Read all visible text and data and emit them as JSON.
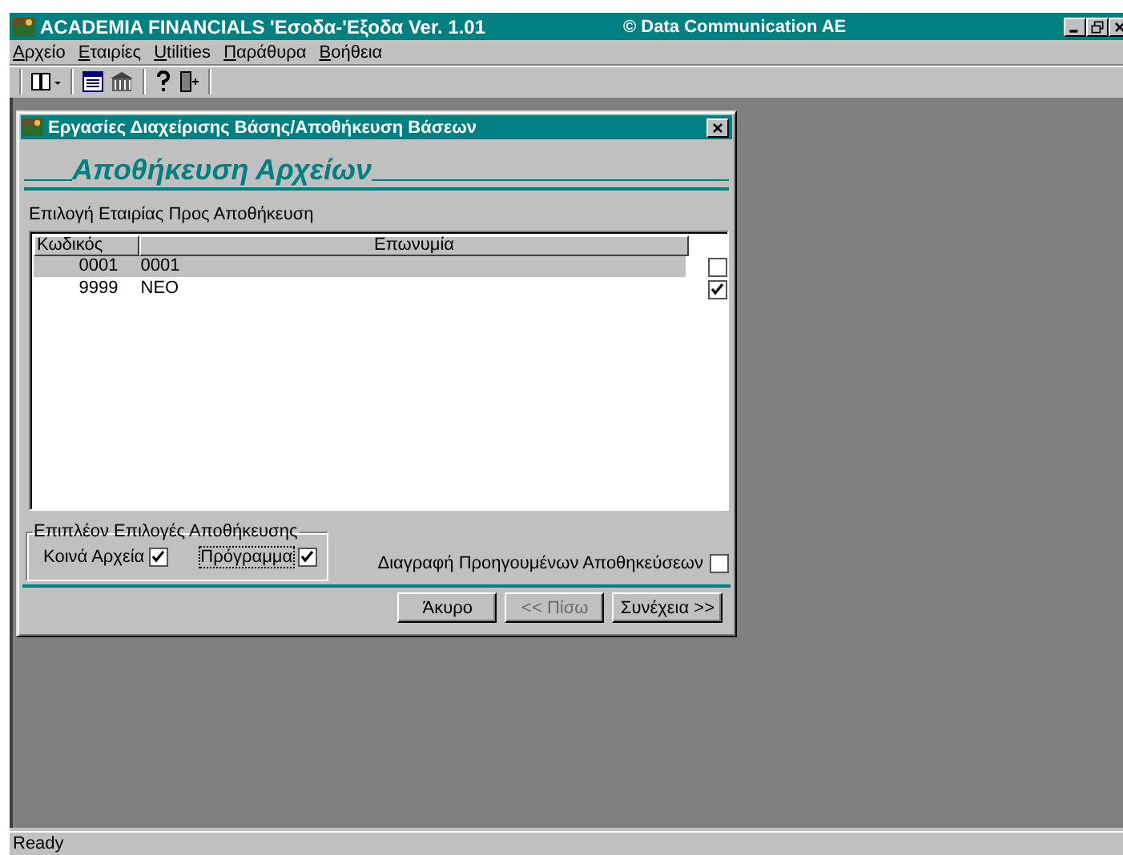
{
  "window": {
    "title": "ACADEMIA FINANCIALS 'Εσοδα-'Εξοδα Ver. 1.01",
    "company": "© Data Communication AE"
  },
  "menu": [
    "Αρχείο",
    "Εταιρίες",
    "Utilities",
    "Παράθυρα",
    "Βοήθεια"
  ],
  "dialog": {
    "title": "Εργασίες Διαχείρισης Βάσης/Αποθήκευση Βάσεων",
    "heading": "Αποθήκευση Αρχείων",
    "list_label": "Επιλογή Εταιρίας Προς Αποθήκευση",
    "table": {
      "columns": [
        "Κωδικός",
        "Επωνυμία"
      ],
      "rows": [
        {
          "code": "0001",
          "name": "0001",
          "selected": true,
          "checked": false
        },
        {
          "code": "9999",
          "name": "NEO",
          "selected": false,
          "checked": true
        }
      ]
    },
    "options_group": {
      "title": "Επιπλέον Επιλογές Αποθήκευσης",
      "options": [
        {
          "label": "Κοινά Αρχεία",
          "checked": true,
          "focused": false
        },
        {
          "label": "Πρόγραμμα",
          "checked": true,
          "focused": true
        }
      ]
    },
    "delete_previous": {
      "label": "Διαγραφή Προηγουμένων Αποθηκεύσεων",
      "checked": false
    },
    "buttons": [
      {
        "label": "Άκυρο",
        "disabled": false
      },
      {
        "label": "<< Πίσω",
        "disabled": true
      },
      {
        "label": "Συνέχεια >>",
        "disabled": false
      }
    ]
  },
  "status_bar": "Ready"
}
